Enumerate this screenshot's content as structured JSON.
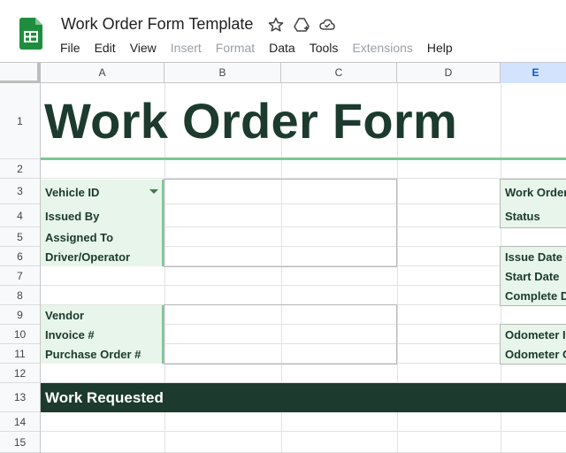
{
  "document": {
    "title": "Work Order Form Template"
  },
  "menu": [
    "File",
    "Edit",
    "View",
    "Insert",
    "Format",
    "Data",
    "Tools",
    "Extensions",
    "Help"
  ],
  "menu_disabled": [
    false,
    false,
    false,
    true,
    true,
    false,
    false,
    true,
    false
  ],
  "columns": [
    "A",
    "B",
    "C",
    "D",
    "E"
  ],
  "selected_column": "E",
  "rows": [
    "1",
    "2",
    "3",
    "4",
    "5",
    "6",
    "7",
    "8",
    "9",
    "10",
    "11",
    "12",
    "13",
    "14",
    "15"
  ],
  "sheet": {
    "form_title": "Work Order Form",
    "left_labels": {
      "vehicle_id": "Vehicle ID",
      "issued_by": "Issued By",
      "assigned_to": "Assigned To",
      "driver_operator": "Driver/Operator",
      "vendor": "Vendor",
      "invoice_no": "Invoice #",
      "purchase_order_no": "Purchase Order #"
    },
    "right_labels": {
      "work_order": "Work Order",
      "status": "Status",
      "issue_date": "Issue Date",
      "start_date": "Start Date",
      "complete_date": "Complete D",
      "odometer_in": "Odometer I",
      "odometer_out": "Odometer C"
    },
    "section_work_requested": "Work Requested"
  },
  "colors": {
    "brand_dark": "#1c3a2e",
    "label_bg": "#e8f5ea",
    "accent_green": "#7cc794",
    "sheets_logo": "#1e8e3e",
    "selected_header": "#d3e3fd"
  },
  "icons": [
    "sheets-logo-icon",
    "star-icon",
    "move-to-drive-icon",
    "cloud-status-icon",
    "dropdown-arrow-icon"
  ]
}
